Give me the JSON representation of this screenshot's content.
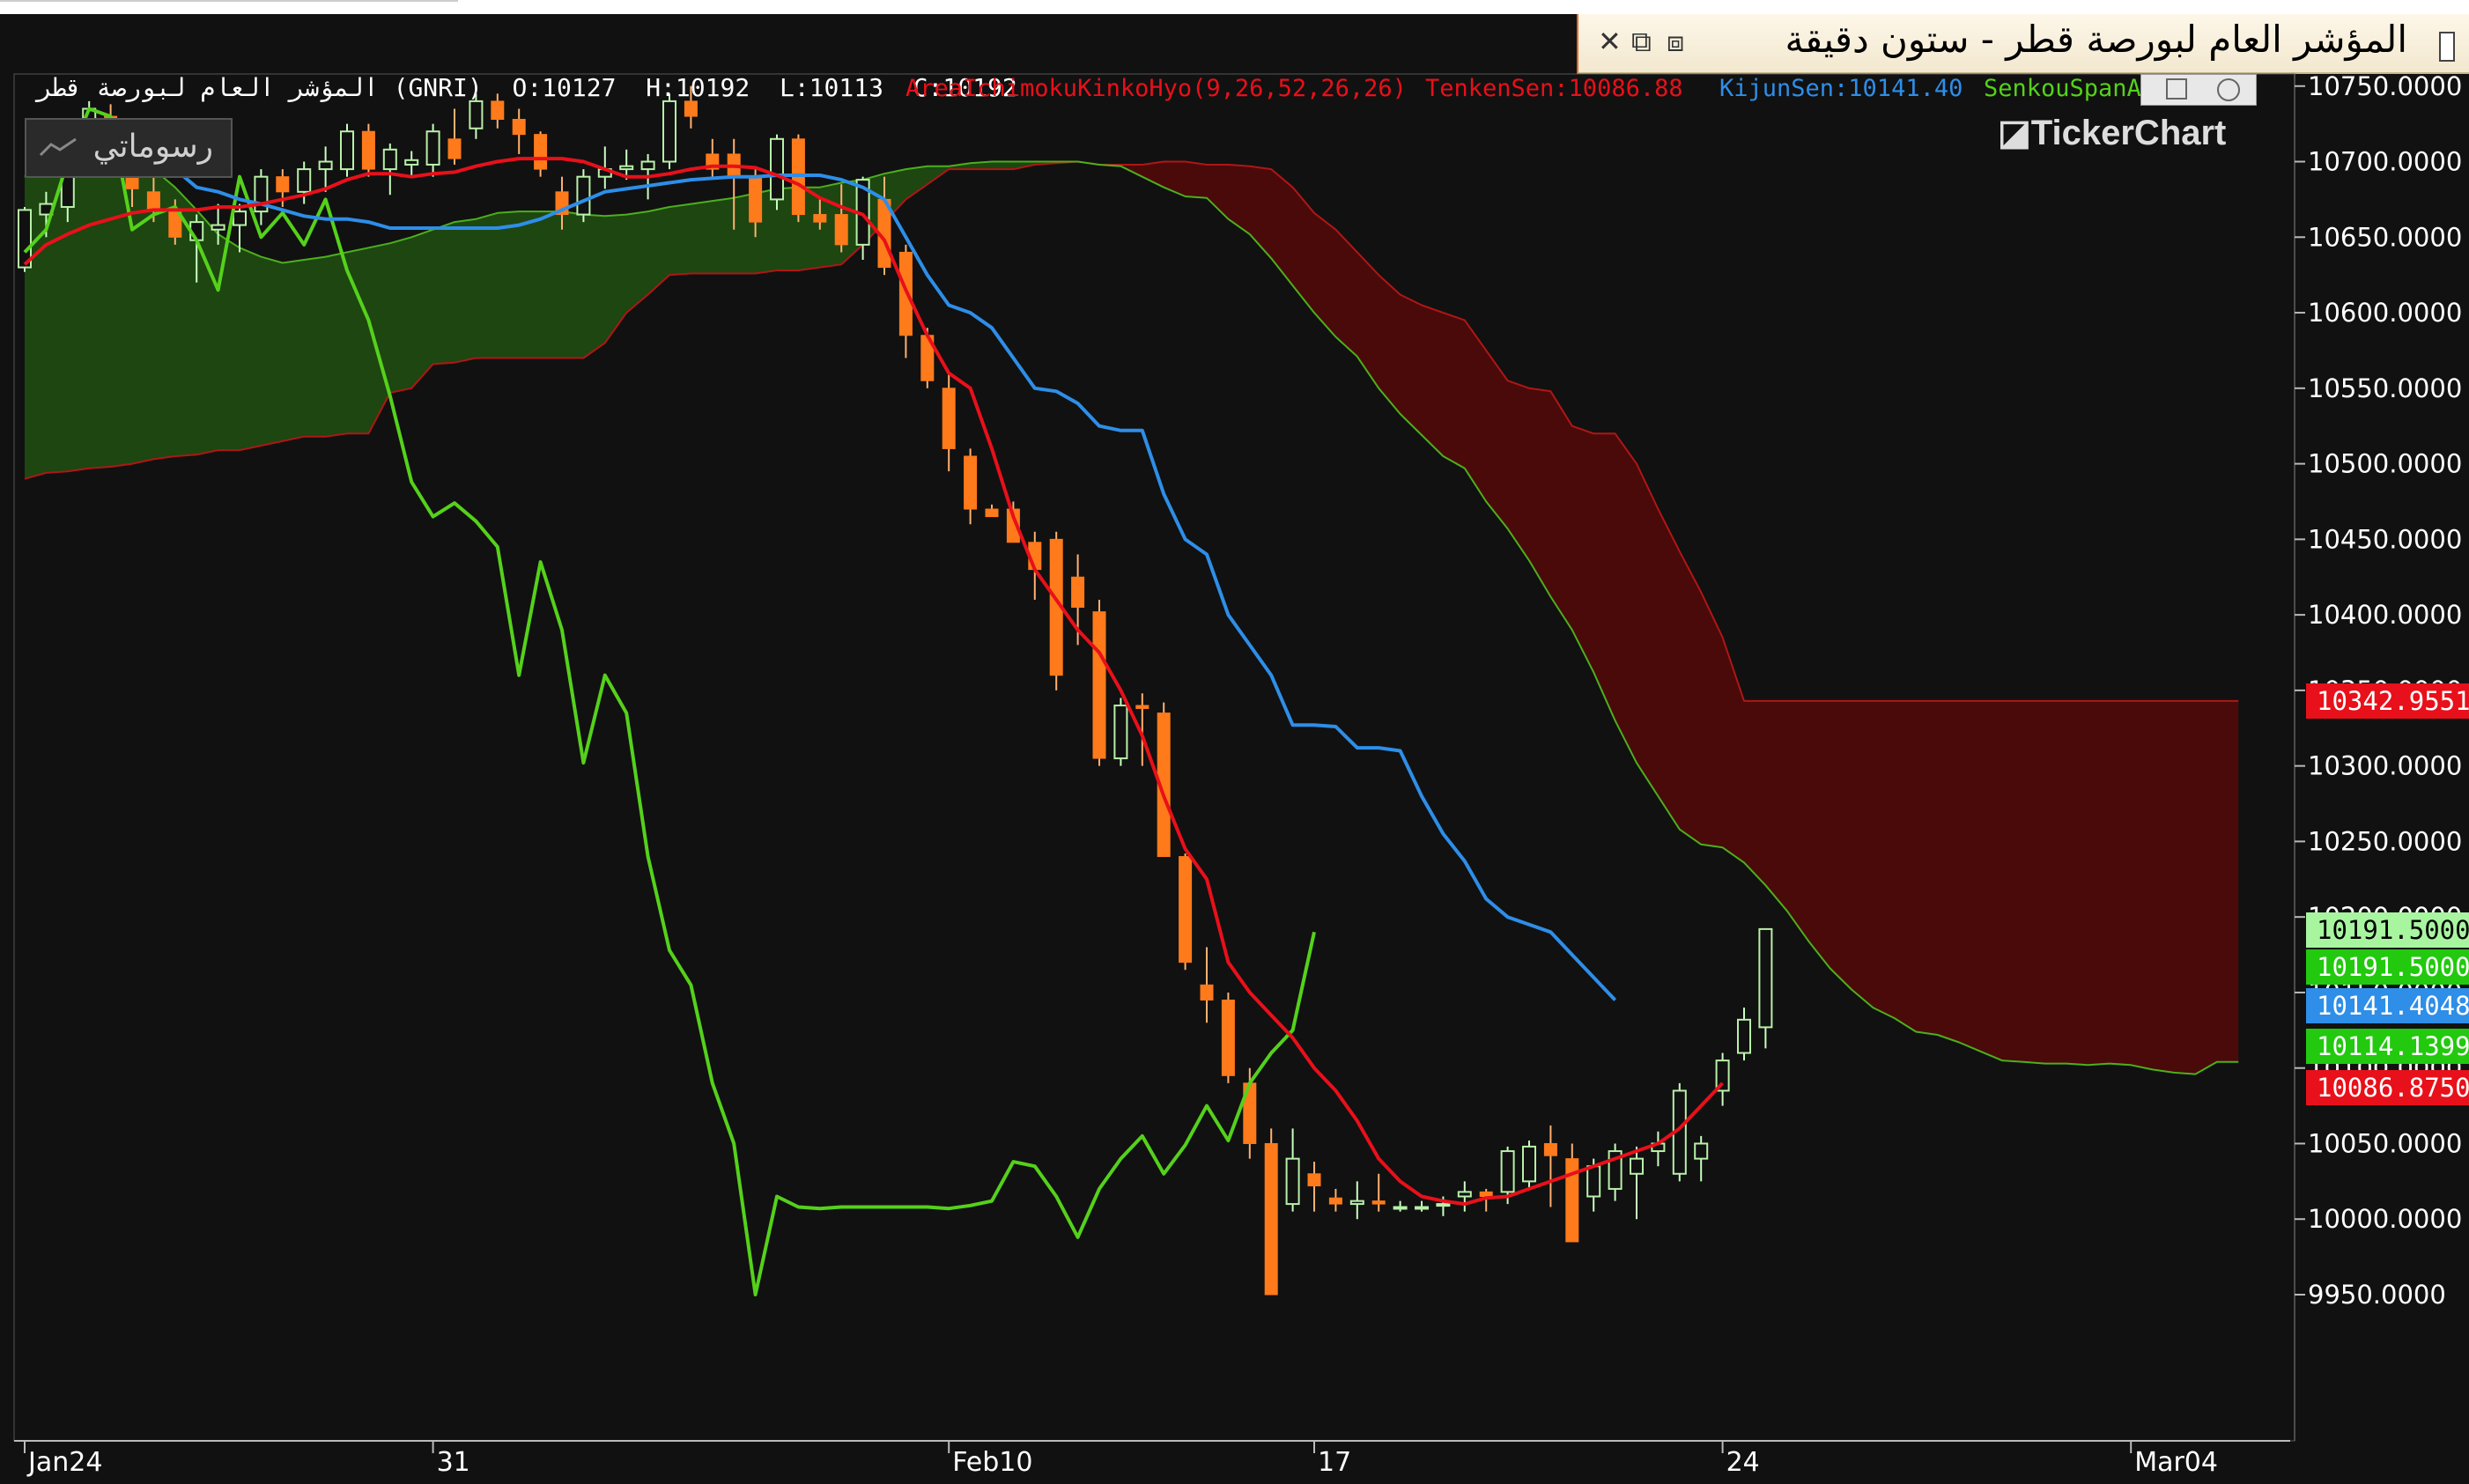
{
  "window": {
    "title": "المؤشر العام لبورصة قطر - ستون دقيقة",
    "close_glyph": "✕",
    "restore_glyph": "⧉",
    "dock_glyph": "⧈"
  },
  "header": {
    "symbol": "المؤشر العام لبورصة قطر (GNRI)",
    "open": "O:10127",
    "high": "H:10192",
    "low": "L:10113",
    "close": "C:10192"
  },
  "indicators": {
    "area_label": "AreaIchimokuKinkoHyo(9,26,52,26,26)",
    "tenkan_label": "TenkenSen:10086.88",
    "kijun_label": "KijunSen:10141.40",
    "senkou_label": "SenkouSpanA",
    "colors": {
      "area": "#e8101a",
      "tenkan": "#e8101a",
      "kijun": "#2e8ee8",
      "senkou": "#55d11b"
    }
  },
  "toolbar": {
    "drawings_label": "رسوماتي"
  },
  "watermark": "TickerChart",
  "price_tags": [
    {
      "label": "10342.9551",
      "bg": "#e8101a",
      "price": 10342.9551
    },
    {
      "label": "10191.5000",
      "bg": "#a8f5a0",
      "price": 10191.5,
      "fg": "#000000"
    },
    {
      "label": "10191.5000",
      "bg": "#22c90e",
      "price": 10191.5
    },
    {
      "label": "10141.4048",
      "bg": "#2e8ee8",
      "price": 10141.4048
    },
    {
      "label": "10114.1399",
      "bg": "#22c90e",
      "price": 10114.1399
    },
    {
      "label": "10086.8750",
      "bg": "#e8101a",
      "price": 10086.875
    }
  ],
  "chart_data": {
    "type": "candlestick",
    "ylim": [
      9910,
      10790
    ],
    "y_ticks": [
      "10750.0000",
      "10700.0000",
      "10650.0000",
      "10600.0000",
      "10550.0000",
      "10500.0000",
      "10450.0000",
      "10400.0000",
      "10350.0000",
      "10300.0000",
      "10250.0000",
      "10200.0000",
      "10150.0000",
      "10100.0000",
      "10050.0000",
      "10000.0000",
      "9950.0000"
    ],
    "x_labels": [
      {
        "label": "Jan24",
        "bar": 0
      },
      {
        "label": "31",
        "bar": 19
      },
      {
        "label": "Feb10",
        "bar": 43
      },
      {
        "label": "17",
        "bar": 60
      },
      {
        "label": "24",
        "bar": 79
      },
      {
        "label": "Mar04",
        "bar": 98
      }
    ],
    "total_bars": 104,
    "candles": [
      [
        10630,
        10670,
        10627,
        10668
      ],
      [
        10665,
        10680,
        10650,
        10672
      ],
      [
        10670,
        10715,
        10660,
        10710
      ],
      [
        10710,
        10740,
        10700,
        10735
      ],
      [
        10730,
        10738,
        10690,
        10700
      ],
      [
        10700,
        10705,
        10670,
        10682
      ],
      [
        10680,
        10690,
        10660,
        10668
      ],
      [
        10668,
        10675,
        10645,
        10650
      ],
      [
        10648,
        10665,
        10620,
        10660
      ],
      [
        10655,
        10672,
        10645,
        10658
      ],
      [
        10658,
        10672,
        10640,
        10667
      ],
      [
        10667,
        10695,
        10658,
        10690
      ],
      [
        10690,
        10695,
        10670,
        10680
      ],
      [
        10680,
        10700,
        10672,
        10695
      ],
      [
        10695,
        10710,
        10680,
        10700
      ],
      [
        10695,
        10725,
        10690,
        10720
      ],
      [
        10720,
        10725,
        10690,
        10695
      ],
      [
        10695,
        10712,
        10678,
        10708
      ],
      [
        10698,
        10707,
        10690,
        10701
      ],
      [
        10698,
        10725,
        10690,
        10720
      ],
      [
        10715,
        10735,
        10698,
        10702
      ],
      [
        10722,
        10745,
        10715,
        10740
      ],
      [
        10740,
        10745,
        10722,
        10728
      ],
      [
        10728,
        10735,
        10705,
        10718
      ],
      [
        10718,
        10720,
        10690,
        10695
      ],
      [
        10680,
        10690,
        10655,
        10665
      ],
      [
        10665,
        10695,
        10660,
        10690
      ],
      [
        10690,
        10710,
        10682,
        10695
      ],
      [
        10695,
        10708,
        10688,
        10697
      ],
      [
        10695,
        10705,
        10675,
        10700
      ],
      [
        10700,
        10745,
        10695,
        10740
      ],
      [
        10740,
        10750,
        10722,
        10730
      ],
      [
        10705,
        10715,
        10690,
        10695
      ],
      [
        10705,
        10715,
        10655,
        10690
      ],
      [
        10690,
        10695,
        10650,
        10660
      ],
      [
        10675,
        10718,
        10668,
        10715
      ],
      [
        10715,
        10718,
        10660,
        10665
      ],
      [
        10665,
        10675,
        10655,
        10660
      ],
      [
        10665,
        10685,
        10640,
        10645
      ],
      [
        10645,
        10690,
        10635,
        10688
      ],
      [
        10675,
        10690,
        10625,
        10630
      ],
      [
        10640,
        10645,
        10570,
        10585
      ],
      [
        10585,
        10590,
        10550,
        10555
      ],
      [
        10550,
        10560,
        10495,
        10510
      ],
      [
        10505,
        10510,
        10460,
        10470
      ],
      [
        10470,
        10473,
        10465,
        10465
      ],
      [
        10470,
        10475,
        10450,
        10448
      ],
      [
        10448,
        10455,
        10410,
        10430
      ],
      [
        10450,
        10455,
        10350,
        10360
      ],
      [
        10425,
        10440,
        10380,
        10405
      ],
      [
        10402,
        10410,
        10300,
        10305
      ],
      [
        10305,
        10345,
        10300,
        10340
      ],
      [
        10340,
        10348,
        10300,
        10338
      ],
      [
        10335,
        10342,
        10240,
        10240
      ],
      [
        10240,
        10242,
        10165,
        10170
      ],
      [
        10155,
        10180,
        10130,
        10145
      ],
      [
        10145,
        10150,
        10090,
        10095
      ],
      [
        10090,
        10100,
        10040,
        10050
      ],
      [
        10050,
        10060,
        9955,
        9950
      ],
      [
        10010,
        10060,
        10005,
        10040
      ],
      [
        10030,
        10038,
        10005,
        10022
      ],
      [
        10014,
        10020,
        10005,
        10010
      ],
      [
        10010,
        10025,
        10000,
        10012
      ],
      [
        10012,
        10030,
        10005,
        10010
      ],
      [
        10008,
        10012,
        10005,
        10008
      ],
      [
        10008,
        10012,
        10005,
        10008
      ],
      [
        10010,
        10015,
        10002,
        10010
      ],
      [
        10015,
        10025,
        10005,
        10018
      ],
      [
        10018,
        10020,
        10005,
        10015
      ],
      [
        10018,
        10048,
        10010,
        10045
      ],
      [
        10025,
        10052,
        10020,
        10048
      ],
      [
        10050,
        10062,
        10008,
        10042
      ],
      [
        10040,
        10050,
        9998,
        9985
      ],
      [
        10015,
        10040,
        10005,
        10035
      ],
      [
        10020,
        10050,
        10012,
        10045
      ],
      [
        10030,
        10048,
        10000,
        10040
      ],
      [
        10045,
        10058,
        10035,
        10050
      ],
      [
        10030,
        10090,
        10025,
        10085
      ],
      [
        10040,
        10055,
        10025,
        10050
      ],
      [
        10085,
        10110,
        10075,
        10105
      ],
      [
        10110,
        10140,
        10105,
        10132
      ],
      [
        10127,
        10192,
        10113,
        10192
      ]
    ],
    "series": [
      {
        "name": "TenkenSen",
        "color": "#e8101a",
        "values": [
          10632,
          10645,
          10652,
          10658,
          10662,
          10666,
          10668,
          10668,
          10668,
          10670,
          10670,
          10672,
          10675,
          10678,
          10682,
          10688,
          10692,
          10692,
          10690,
          10692,
          10693,
          10697,
          10700,
          10702,
          10702,
          10702,
          10700,
          10695,
          10690,
          10690,
          10692,
          10695,
          10697,
          10697,
          10696,
          10691,
          10685,
          10676,
          10670,
          10665,
          10648,
          10615,
          10585,
          10560,
          10550,
          10510,
          10465,
          10430,
          10410,
          10390,
          10375,
          10350,
          10320,
          10280,
          10245,
          10225,
          10170,
          10150,
          10135,
          10120,
          10100,
          10085,
          10065,
          10040,
          10025,
          10015,
          10012,
          10010,
          10014,
          10015,
          10020,
          10025,
          10030,
          10035,
          10040,
          10045,
          10050,
          10060,
          10075,
          10090
        ]
      },
      {
        "name": "KijunSen",
        "color": "#2e8ee8",
        "values": [
          10695,
          10695,
          10695,
          10695,
          10695,
          10695,
          10695,
          10695,
          10683,
          10680,
          10675,
          10672,
          10668,
          10664,
          10662,
          10662,
          10660,
          10656,
          10656,
          10656,
          10656,
          10656,
          10656,
          10658,
          10662,
          10668,
          10674,
          10680,
          10682,
          10684,
          10686,
          10688,
          10689,
          10690,
          10690,
          10691,
          10691,
          10691,
          10688,
          10683,
          10675,
          10650,
          10625,
          10605,
          10600,
          10590,
          10570,
          10550,
          10548,
          10540,
          10525,
          10522,
          10522,
          10480,
          10450,
          10440,
          10400,
          10380,
          10360,
          10327,
          10327,
          10326,
          10312,
          10312,
          10310,
          10280,
          10255,
          10237,
          10212,
          10200,
          10195,
          10190,
          10175,
          10160,
          10145
        ]
      },
      {
        "name": "SenkouSpanA",
        "color": "#55d11b",
        "values": [
          10690,
          10710,
          10717,
          10715,
          10718,
          10714,
          10695,
          10683,
          10668,
          10652,
          10643,
          10637,
          10633,
          10635,
          10637,
          10640,
          10643,
          10646,
          10650,
          10655,
          10660,
          10662,
          10666,
          10667,
          10667,
          10667,
          10665,
          10664,
          10665,
          10667,
          10670,
          10672,
          10674,
          10676,
          10679,
          10682,
          10683,
          10683,
          10686,
          10688,
          10692,
          10695,
          10697,
          10697,
          10699,
          10700,
          10700,
          10700,
          10700,
          10700,
          10698,
          10697,
          10690,
          10683,
          10677,
          10676,
          10662,
          10652,
          10636,
          10618,
          10600,
          10584,
          10571,
          10550,
          10533,
          10519,
          10505,
          10497,
          10475,
          10457,
          10436,
          10412,
          10390,
          10362,
          10330,
          10302,
          10280,
          10258,
          10248,
          10246,
          10236,
          10221,
          10204,
          10184,
          10166,
          10152,
          10140,
          10133,
          10124,
          10122,
          10117,
          10111,
          10105,
          10104,
          10103,
          10103,
          10102,
          10103,
          10102,
          10099,
          10097,
          10096,
          10104,
          10104
        ]
      },
      {
        "name": "SenkouSpanB",
        "values": [
          10490,
          10494,
          10495,
          10497,
          10498,
          10500,
          10503,
          10505,
          10506,
          10509,
          10509,
          10512,
          10515,
          10518,
          10518,
          10520,
          10520,
          10547,
          10550,
          10566,
          10567,
          10570,
          10570,
          10570,
          10570,
          10570,
          10570,
          10580,
          10600,
          10612,
          10625,
          10626,
          10626,
          10626,
          10626,
          10628,
          10628,
          10630,
          10632,
          10645,
          10660,
          10675,
          10685,
          10695,
          10695,
          10695,
          10695,
          10698,
          10699,
          10700,
          10698,
          10698,
          10698,
          10700,
          10700,
          10698,
          10698,
          10697,
          10695,
          10683,
          10666,
          10655,
          10640,
          10625,
          10612,
          10605,
          10600,
          10595,
          10575,
          10555,
          10550,
          10548,
          10525,
          10520,
          10520,
          10500,
          10470,
          10442,
          10415,
          10385,
          10343,
          10343,
          10343,
          10343,
          10343,
          10343,
          10343,
          10343,
          10343,
          10343,
          10343,
          10343,
          10343,
          10343,
          10343,
          10343,
          10343,
          10343,
          10343,
          10343,
          10343,
          10343,
          10343,
          10343
        ]
      },
      {
        "name": "ChikouSpan",
        "color": "#55d11b",
        "values": [
          10640,
          10655,
          10700,
          10735,
          10730,
          10655,
          10665,
          10670,
          10648,
          10615,
          10690,
          10650,
          10666,
          10645,
          10675,
          10628,
          10595,
          10545,
          10488,
          10465,
          10474,
          10462,
          10445,
          10360,
          10435,
          10390,
          10302,
          10360,
          10335,
          10240,
          10178,
          10155,
          10090,
          10050,
          9950,
          10015,
          10008,
          10007,
          10008,
          10008,
          10008,
          10008,
          10008,
          10007,
          10009,
          10012,
          10038,
          10035,
          10015,
          9988,
          10020,
          10040,
          10055,
          10030,
          10049,
          10075,
          10052,
          10090,
          10110,
          10125,
          10190
        ]
      }
    ]
  }
}
